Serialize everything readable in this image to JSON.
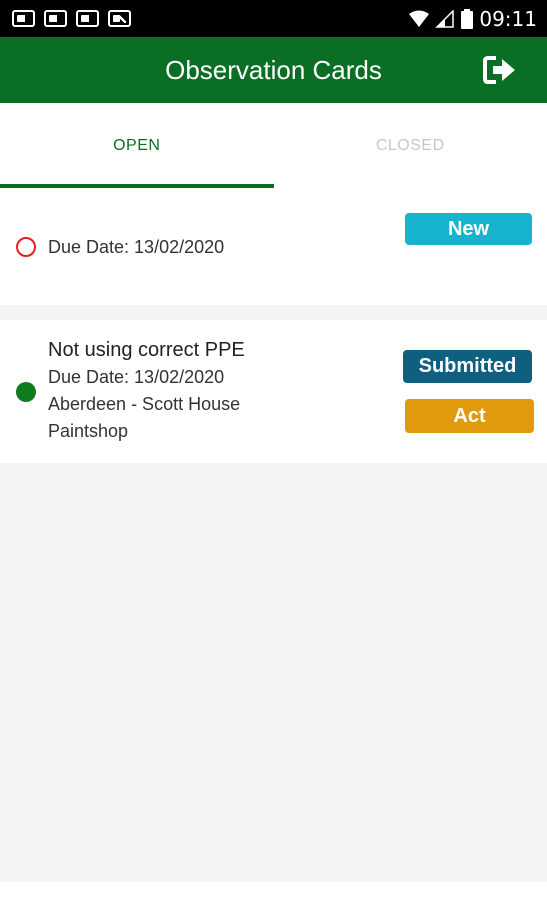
{
  "status_bar": {
    "time": "09:11",
    "notification_icons": [
      "notification-icon",
      "notification-icon",
      "notification-icon",
      "notification-icon-alt"
    ],
    "system_icons": [
      "wifi-icon",
      "signal-icon",
      "battery-icon"
    ]
  },
  "app_bar": {
    "title": "Observation Cards",
    "logout_icon": "logout-icon",
    "color": "#0b6e25"
  },
  "tabs": [
    {
      "label": "OPEN",
      "active": true
    },
    {
      "label": "CLOSED",
      "active": false
    }
  ],
  "cards": [
    {
      "title": "",
      "due_date": "Due Date: 13/02/2020",
      "location": "",
      "department": "",
      "status_indicator": "open-circle",
      "badges": [
        {
          "label": "New",
          "color": "#17b2cd"
        }
      ]
    },
    {
      "title": "Not using correct PPE",
      "due_date": "Due Date: 13/02/2020",
      "location": "Aberdeen - Scott House",
      "department": "Paintshop",
      "status_indicator": "filled-circle",
      "badges": [
        {
          "label": "Submitted",
          "color": "#0e5f80"
        },
        {
          "label": "Act",
          "color": "#e09a0b"
        }
      ]
    }
  ]
}
